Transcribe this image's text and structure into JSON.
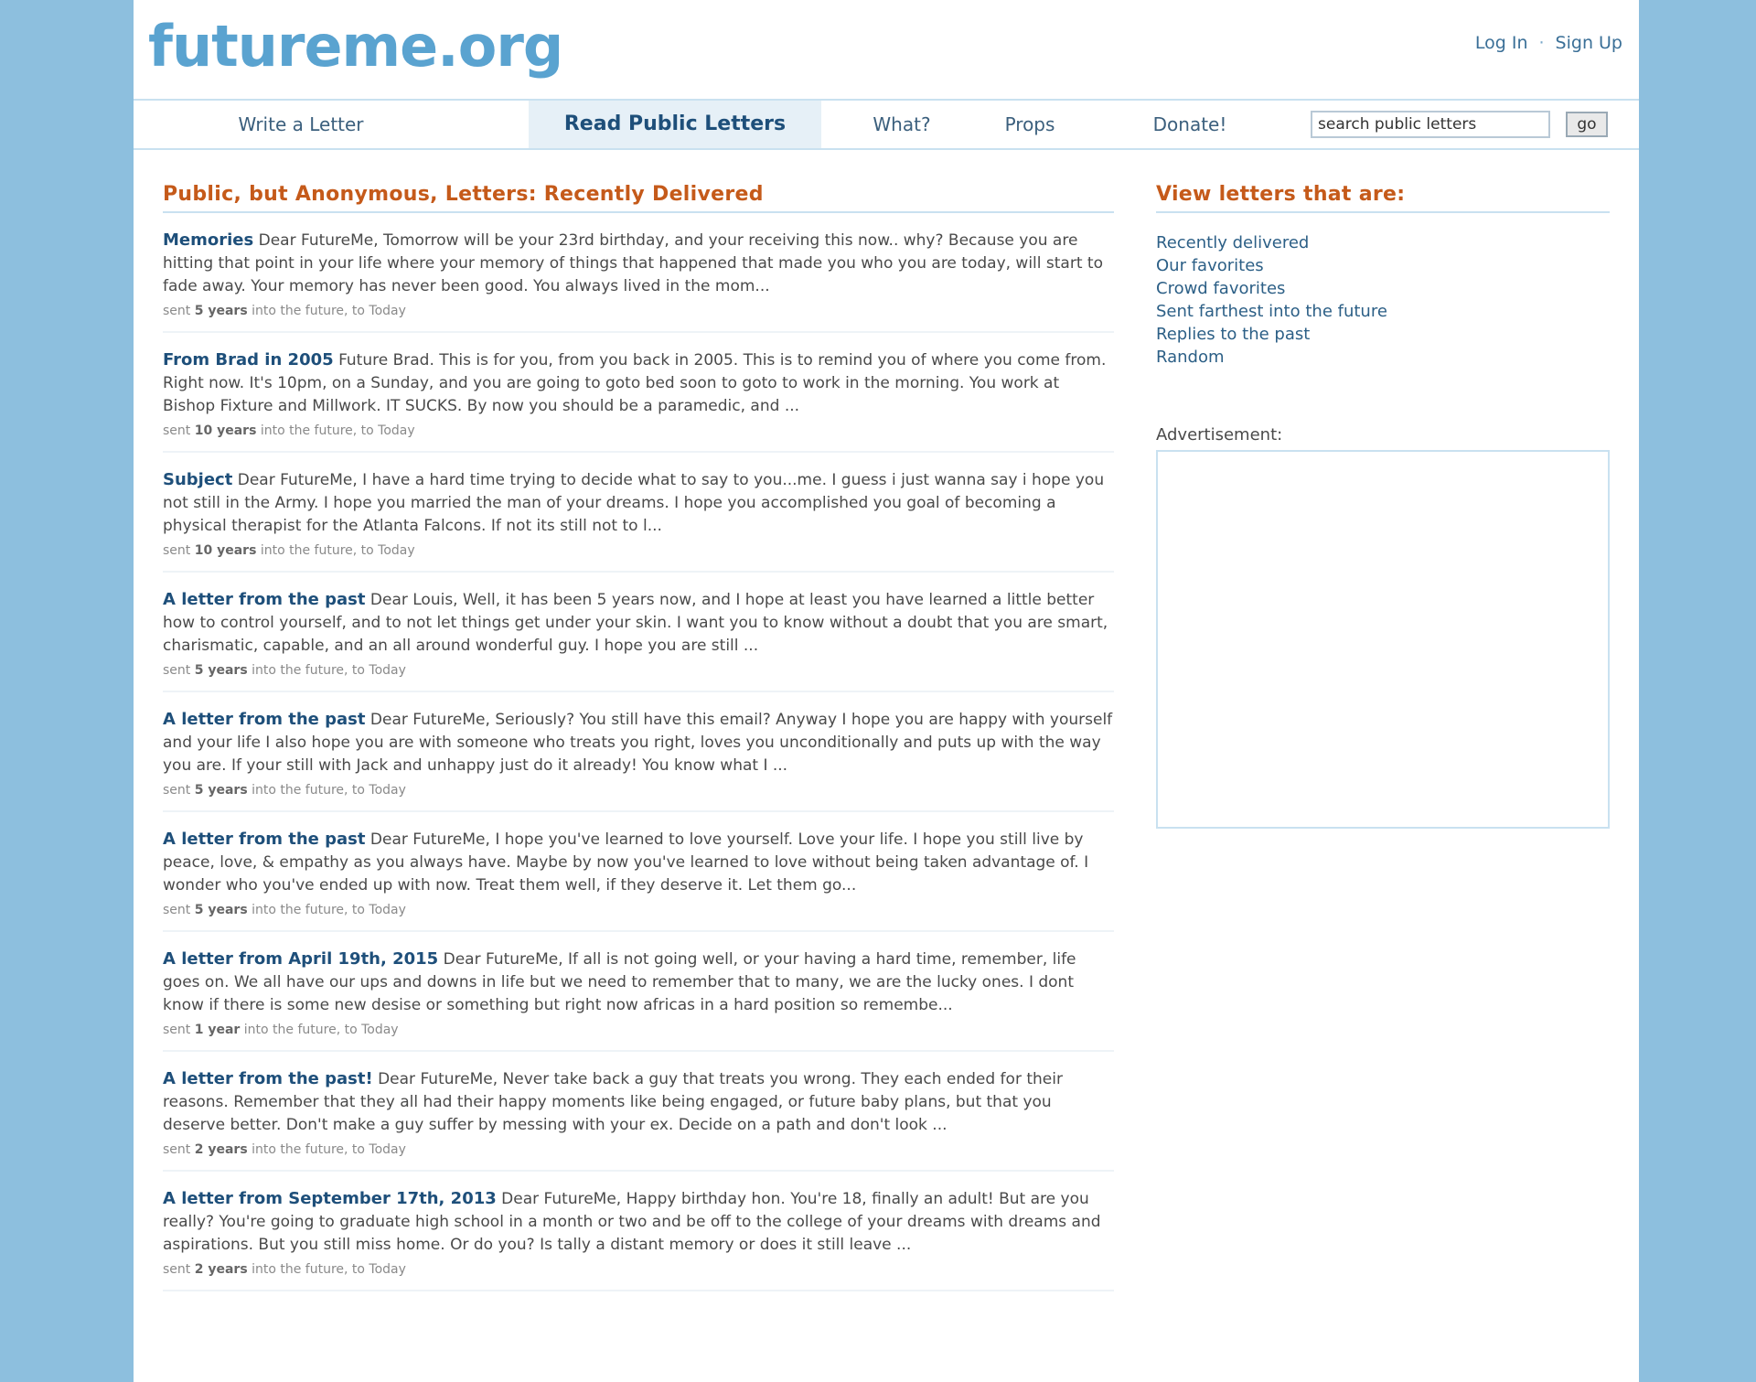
{
  "site": {
    "logo": "futureme.org",
    "login_label": "Log In",
    "separator": "·",
    "signup_label": "Sign Up"
  },
  "nav": {
    "items": [
      {
        "label": "Write a Letter"
      },
      {
        "label": "Read Public Letters",
        "active": true
      },
      {
        "label": "What?"
      },
      {
        "label": "Props"
      },
      {
        "label": "Donate!"
      }
    ],
    "search": {
      "value": "search public letters",
      "button_label": "go"
    }
  },
  "main": {
    "title": "Public, but Anonymous, Letters: Recently Delivered",
    "letters": [
      {
        "title": "Memories",
        "excerpt": "Dear FutureMe, Tomorrow will be your 23rd birthday, and your receiving this now.. why? Because you are hitting that point in your life where your memory of things that happened that made you who you are today, will start to fade away. Your memory has never been good. You always lived in the mom...",
        "sent_prefix": "sent",
        "duration": "5 years",
        "sent_suffix": "into the future, to Today"
      },
      {
        "title": "From Brad in 2005",
        "excerpt": "Future Brad. This is for you, from you back in 2005. This is to remind you of where you come from. Right now. It's 10pm, on a Sunday, and you are going to goto bed soon to goto to work in the morning. You work at Bishop Fixture and Millwork. IT SUCKS. By now you should be a paramedic, and ...",
        "sent_prefix": "sent",
        "duration": "10 years",
        "sent_suffix": "into the future, to Today"
      },
      {
        "title": "Subject",
        "excerpt": "Dear FutureMe, I have a hard time trying to decide what to say to you...me. I guess i just wanna say i hope you not still in the Army. I hope you married the man of your dreams. I hope you accomplished you goal of becoming a physical therapist for the Atlanta Falcons. If not its still not to l...",
        "sent_prefix": "sent",
        "duration": "10 years",
        "sent_suffix": "into the future, to Today"
      },
      {
        "title": "A letter from the past",
        "excerpt": "Dear Louis, Well, it has been 5 years now, and I hope at least you have learned a little better how to control yourself, and to not let things get under your skin. I want you to know without a doubt that you are smart, charismatic, capable, and an all around wonderful guy. I hope you are still ...",
        "sent_prefix": "sent",
        "duration": "5 years",
        "sent_suffix": "into the future, to Today"
      },
      {
        "title": "A letter from the past",
        "excerpt": "Dear FutureMe, Seriously? You still have this email? Anyway I hope you are happy with yourself and your life I also hope you are with someone who treats you right, loves you unconditionally and puts up with the way you are. If your still with Jack and unhappy just do it already! You know what I ...",
        "sent_prefix": "sent",
        "duration": "5 years",
        "sent_suffix": "into the future, to Today"
      },
      {
        "title": "A letter from the past",
        "excerpt": "Dear FutureMe, I hope you've learned to love yourself. Love your life. I hope you still live by peace, love, & empathy as you always have. Maybe by now you've learned to love without being taken advantage of. I wonder who you've ended up with now. Treat them well, if they deserve it. Let them go...",
        "sent_prefix": "sent",
        "duration": "5 years",
        "sent_suffix": "into the future, to Today"
      },
      {
        "title": "A letter from April 19th, 2015",
        "excerpt": "Dear FutureMe, If all is not going well, or your having a hard time, remember, life goes on. We all have our ups and downs in life but we need to remember that to many, we are the lucky ones. I dont know if there is some new desise or something but right now africas in a hard position so remembe...",
        "sent_prefix": "sent",
        "duration": "1 year",
        "sent_suffix": "into the future, to Today"
      },
      {
        "title": "A letter from the past!",
        "excerpt": "Dear FutureMe, Never take back a guy that treats you wrong. They each ended for their reasons. Remember that they all had their happy moments like being engaged, or future baby plans, but that you deserve better. Don't make a guy suffer by messing with your ex. Decide on a path and don't look ...",
        "sent_prefix": "sent",
        "duration": "2 years",
        "sent_suffix": "into the future, to Today"
      },
      {
        "title": "A letter from September 17th, 2013",
        "excerpt": "Dear FutureMe, Happy birthday hon. You're 18, finally an adult! But are you really? You're going to graduate high school in a month or two and be off to the college of your dreams with dreams and aspirations. But you still miss home. Or do you? Is tally a distant memory or does it still leave ...",
        "sent_prefix": "sent",
        "duration": "2 years",
        "sent_suffix": "into the future, to Today"
      }
    ]
  },
  "sidebar": {
    "title": "View letters that are:",
    "links": [
      "Recently delivered",
      "Our favorites",
      "Crowd favorites",
      "Sent farthest into the future",
      "Replies to the past",
      "Random"
    ],
    "ad_label": "Advertisement:"
  },
  "colors": {
    "background": "#8dbfde",
    "logo": "#5aa3d0",
    "heading": "#c55a1a",
    "link": "#1e4f7a"
  }
}
